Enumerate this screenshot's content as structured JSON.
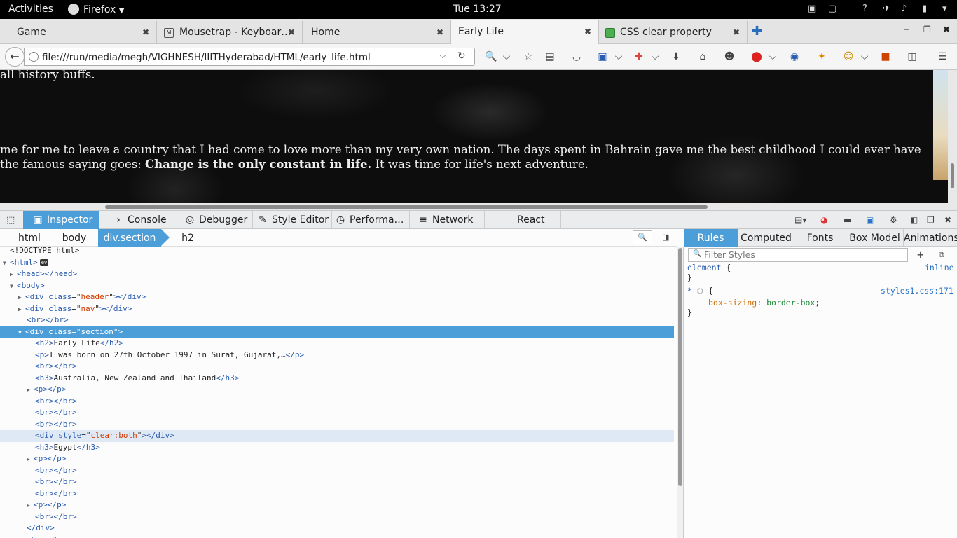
{
  "topbar": {
    "activities": "Activities",
    "app_name": "Firefox",
    "clock": "Tue 13:27"
  },
  "tabs": [
    {
      "label": "Game"
    },
    {
      "label": "Mousetrap - Keyboar…"
    },
    {
      "label": "Home"
    },
    {
      "label": "Early Life"
    },
    {
      "label": "CSS clear property"
    }
  ],
  "navbar": {
    "url": "file:///run/media/megh/VIGHNESH/IIITHyderabad/HTML/early_life.html"
  },
  "page": {
    "line1": "all history buffs.",
    "line2": "me for me to leave a country that I had come to love more than my very own nation. The days spent in Bahrain gave me the best childhood I could ever have",
    "line3_pre": "the famous saying goes: ",
    "line3_bold": "Change is the only constant in life.",
    "line3_post": " It was time for life's next adventure."
  },
  "devtools": {
    "tabs": [
      "Inspector",
      "Console",
      "Debugger",
      "Style Editor",
      "Performa…",
      "Network",
      "React"
    ],
    "breadcrumbs": [
      "html",
      "body",
      "div.section",
      "h2"
    ],
    "rules_tabs": [
      "Rules",
      "Computed",
      "Fonts",
      "Box Model",
      "Animations"
    ],
    "filter_placeholder": "Filter Styles",
    "rules": {
      "r1_selector": "element",
      "r1_open": "{",
      "r1_source": "inline",
      "r1_close": "}",
      "r2_selector": "*",
      "r2_open": "{",
      "r2_source": "styles1.css:171",
      "r2_prop": "box-sizing",
      "r2_val": "border-box",
      "r2_close": "}"
    }
  },
  "markup": {
    "doctype": "<!DOCTYPE html>",
    "html_tag": "html",
    "ev_badge": "ev",
    "head_tag": "head",
    "body_tag": "body",
    "div": "div",
    "class_attr": "class",
    "header_val": "header",
    "nav_val": "nav",
    "section_val": "section",
    "br": "br",
    "h2": "h2",
    "h2_text": "Early Life",
    "p": "p",
    "p_text": "I was born on 27th October 1997 in Surat, Gujarat,…",
    "h3": "h3",
    "h3_text1": "Australia, New Zealand and Thailand",
    "style_attr": "style",
    "style_val": "clear:both",
    "h3_text2": "Egypt"
  }
}
